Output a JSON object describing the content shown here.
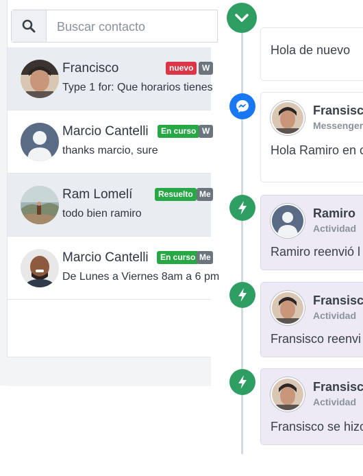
{
  "search": {
    "placeholder": "Buscar contacto"
  },
  "contacts": [
    {
      "name": "Francisco",
      "message": "Type 1 for: Que horarios tienes",
      "badges": [
        "nuevo",
        "W"
      ],
      "selected": true
    },
    {
      "name": "Marcio Cantelli",
      "message": "thanks marcio, sure",
      "badges": [
        "En curso",
        "W"
      ],
      "selected": false
    },
    {
      "name": "Ram Lomelí",
      "message": "todo bien ramiro",
      "badges": [
        "Resuelto",
        "Me"
      ],
      "selected": true
    },
    {
      "name": "Marcio Cantelli",
      "message": "De Lunes a Viernes 8am a 6 pm",
      "badges": [
        "En curso",
        "Me"
      ],
      "selected": false
    }
  ],
  "timeline": {
    "items": [
      {
        "name": "",
        "source": "",
        "body": "Hola de nuevo",
        "icon": "none",
        "style": "white"
      },
      {
        "name": "Fransisco",
        "source": "Messenger",
        "body": "Hola Ramiro en c",
        "icon": "messenger-icon",
        "style": "white"
      },
      {
        "name": "Ramiro",
        "source": "Actividad",
        "body": "Ramiro reenvió l",
        "icon": "bolt-icon",
        "style": "purple"
      },
      {
        "name": "Fransisco",
        "source": "Actividad",
        "body": "Fransisco reenvi",
        "icon": "bolt-icon",
        "style": "purple"
      },
      {
        "name": "Fransisco",
        "source": "Actividad",
        "body": "Fransisco se hizo",
        "icon": "bolt-icon",
        "style": "purple"
      }
    ]
  },
  "colors": {
    "green": "#2e9e62",
    "messenger_blue": "#1877f2",
    "badge_red": "#dc3545",
    "badge_green": "#28a745",
    "badge_gray": "#6c757d",
    "activity_card": "#edeaf6"
  }
}
